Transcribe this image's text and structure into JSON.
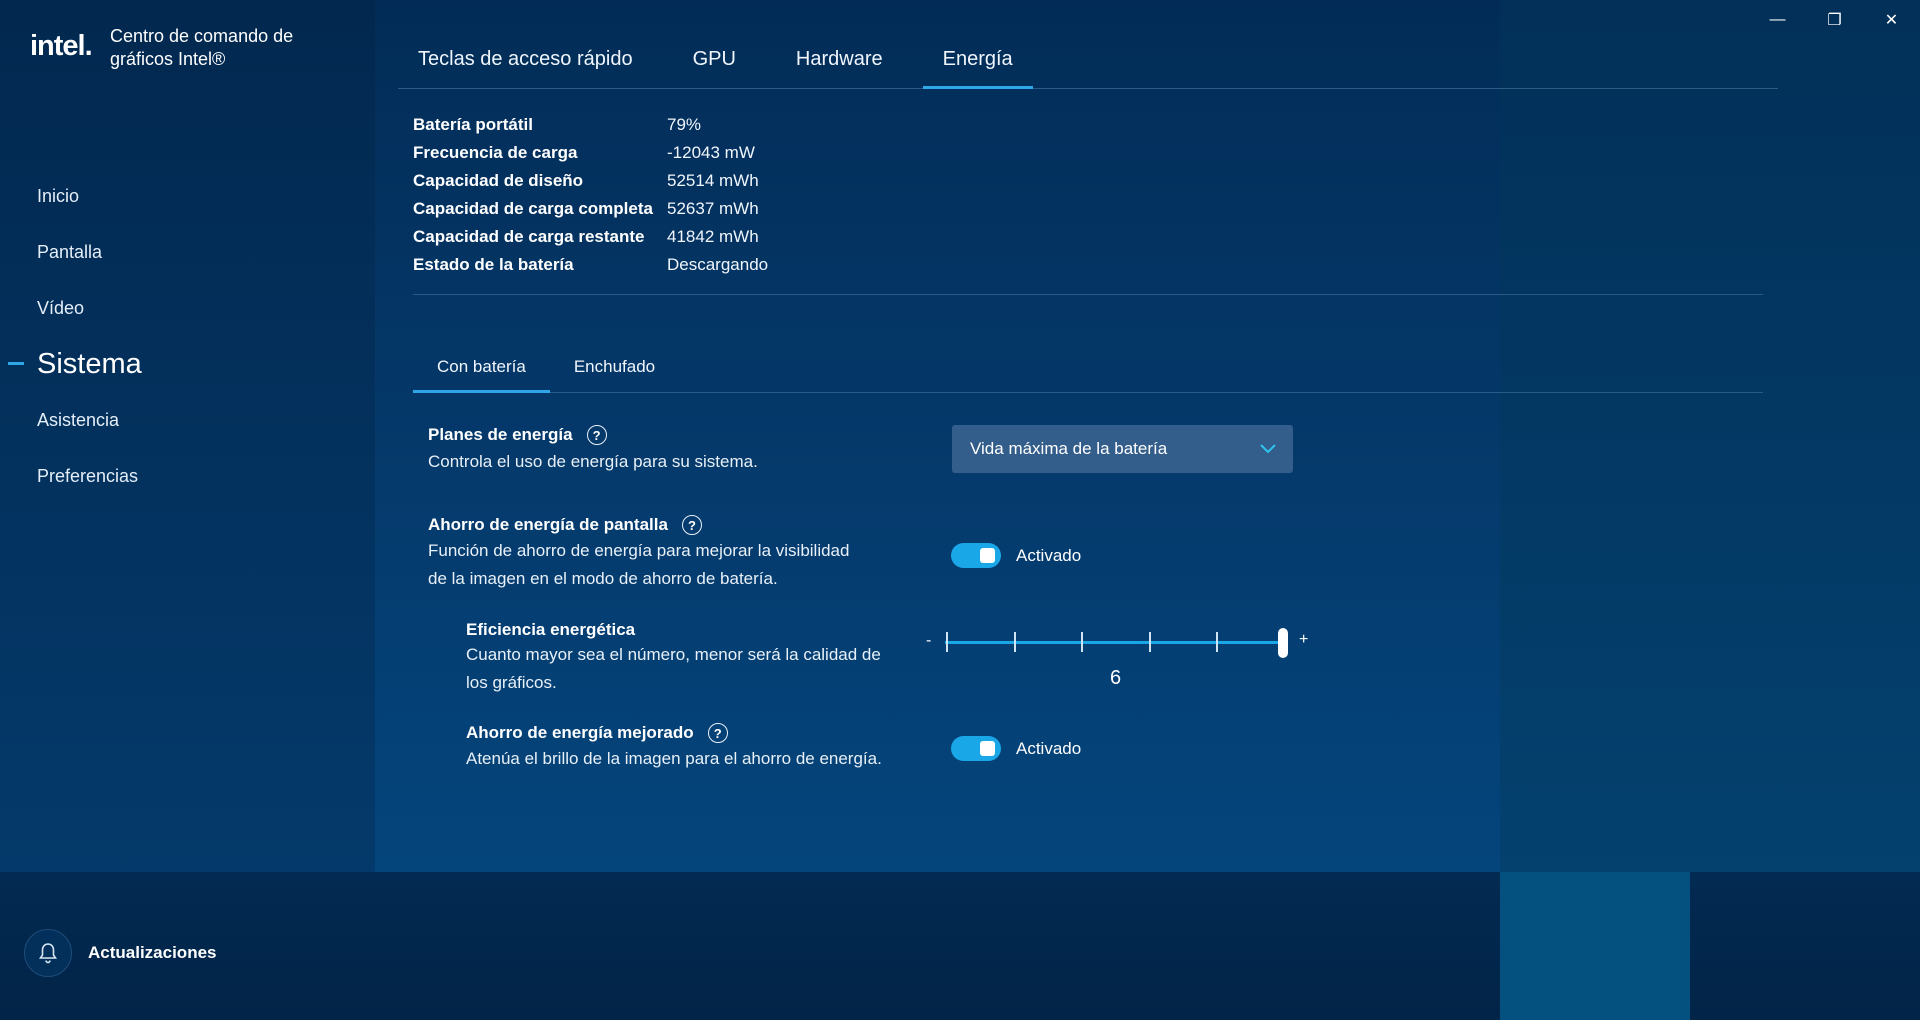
{
  "app": {
    "logo": "intel.",
    "title": "Centro de comando de gráficos Intel®"
  },
  "window": {
    "minimize": "—",
    "restore": "❐",
    "close": "✕"
  },
  "nav": {
    "items": [
      {
        "label": "Inicio",
        "active": false
      },
      {
        "label": "Pantalla",
        "active": false
      },
      {
        "label": "Vídeo",
        "active": false
      },
      {
        "label": "Sistema",
        "active": true
      },
      {
        "label": "Asistencia",
        "active": false
      },
      {
        "label": "Preferencias",
        "active": false
      }
    ]
  },
  "tabs": [
    {
      "label": "Teclas de acceso rápido",
      "active": false
    },
    {
      "label": "GPU",
      "active": false
    },
    {
      "label": "Hardware",
      "active": false
    },
    {
      "label": "Energía",
      "active": true
    }
  ],
  "battery": {
    "rows": [
      {
        "label": "Batería portátil",
        "value": "79%"
      },
      {
        "label": "Frecuencia de carga",
        "value": "-12043 mW"
      },
      {
        "label": "Capacidad de diseño",
        "value": "52514 mWh"
      },
      {
        "label": "Capacidad de carga completa",
        "value": "52637 mWh"
      },
      {
        "label": "Capacidad de carga restante",
        "value": "41842 mWh"
      },
      {
        "label": "Estado de la batería",
        "value": "Descargando"
      }
    ]
  },
  "subtabs": [
    {
      "label": "Con batería",
      "active": true
    },
    {
      "label": "Enchufado",
      "active": false
    }
  ],
  "settings": {
    "power_plans": {
      "title": "Planes de energía",
      "desc": "Controla el uso de energía para su sistema.",
      "selected": "Vida máxima de la batería"
    },
    "display_saver": {
      "title": "Ahorro de energía de pantalla",
      "desc_line1": "Función de ahorro de energía para mejorar la visibilidad",
      "desc_line2": "de la imagen en el modo de ahorro de batería.",
      "state_label": "Activado",
      "enabled": true
    },
    "efficiency": {
      "title": "Eficiencia energética",
      "desc_line1": "Cuanto mayor sea el número, menor será la calidad de",
      "desc_line2": "los gráficos.",
      "min_label": "-",
      "max_label": "+",
      "value": "6",
      "min": 1,
      "max": 6
    },
    "enhanced_saver": {
      "title": "Ahorro de energía mejorado",
      "desc": "Atenúa el brillo de la imagen para el ahorro de energía.",
      "state_label": "Activado",
      "enabled": true
    }
  },
  "footer": {
    "updates_label": "Actualizaciones"
  },
  "colors": {
    "accent": "#1aa7e8",
    "background": "#053261",
    "dropdown": "#335d8a"
  }
}
